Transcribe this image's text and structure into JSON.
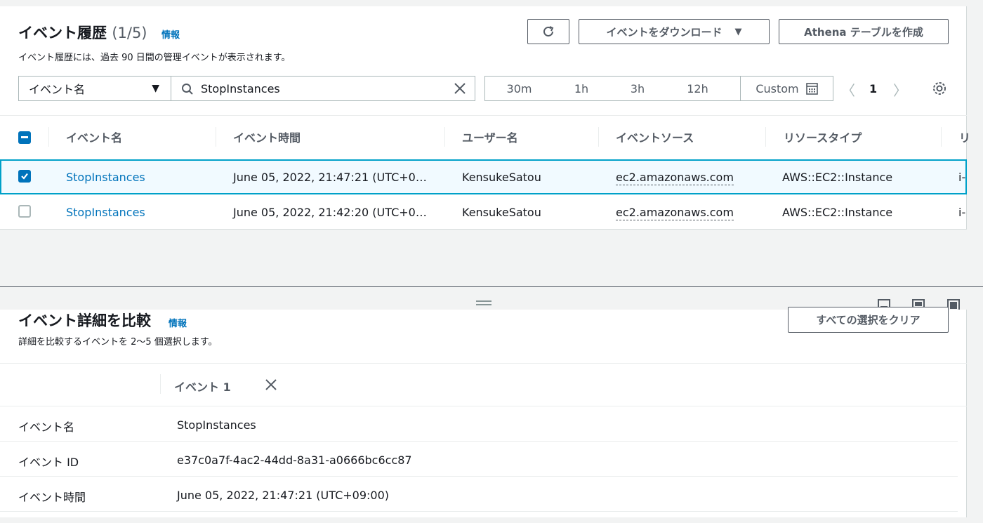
{
  "history": {
    "title": "イベント履歴",
    "count": "(1/5)",
    "info": "情報",
    "description": "イベント履歴には、過去 90 日間の管理イベントが表示されます。",
    "refresh_icon": "refresh-icon",
    "download_button": "イベントをダウンロード",
    "athena_button": "Athena テーブルを作成",
    "filter_select": "イベント名",
    "search_value": "StopInstances",
    "time_ranges": [
      "30m",
      "1h",
      "3h",
      "12h",
      "Custom"
    ],
    "page_number": "1",
    "columns": [
      "イベント名",
      "イベント時間",
      "ユーザー名",
      "イベントソース",
      "リソースタイプ",
      "リ"
    ],
    "rows": [
      {
        "checked": true,
        "event_name": "StopInstances",
        "event_time": "June 05, 2022, 21:47:21 (UTC+0…",
        "user_name": "KensukeSatou",
        "event_source": "ec2.amazonaws.com",
        "resource_type": "AWS::EC2::Instance",
        "resource_name": "i-"
      },
      {
        "checked": false,
        "event_name": "StopInstances",
        "event_time": "June 05, 2022, 21:42:20 (UTC+0…",
        "user_name": "KensukeSatou",
        "event_source": "ec2.amazonaws.com",
        "resource_type": "AWS::EC2::Instance",
        "resource_name": "i-"
      }
    ]
  },
  "compare": {
    "title": "イベント詳細を比較",
    "info": "情報",
    "description": "詳細を比較するイベントを 2〜5 個選択します。",
    "clear_button": "すべての選択をクリア",
    "column_header": "イベント 1",
    "rows": [
      {
        "label": "イベント名",
        "value": "StopInstances",
        "link": true
      },
      {
        "label": "イベント ID",
        "value": "e37c0a7f-4ac2-44dd-8a31-a0666bc6cc87",
        "link": false
      },
      {
        "label": "イベント時間",
        "value": "June 05, 2022, 21:47:21 (UTC+09:00)",
        "link": false
      }
    ]
  },
  "colors": {
    "accent": "#0073bb",
    "selected_row_border": "#00a1c9",
    "selected_row_bg": "#f1faff"
  }
}
